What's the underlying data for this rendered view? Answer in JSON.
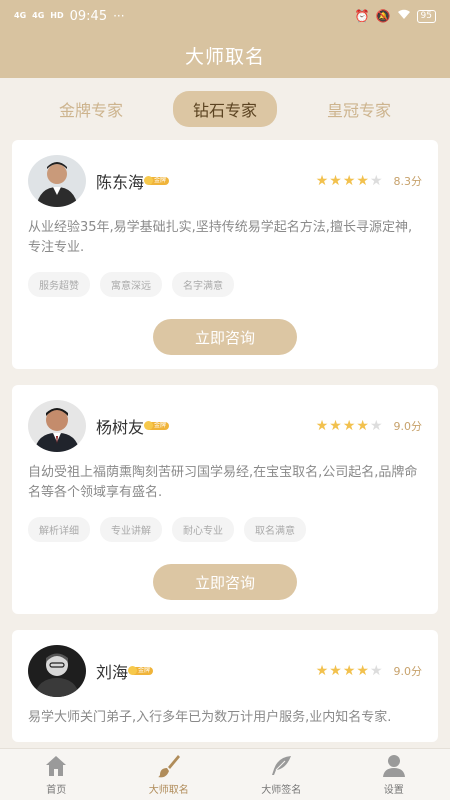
{
  "status_bar": {
    "signal1": "4G",
    "signal2": "4G",
    "hd": "HD",
    "time": "09:45",
    "more": "···",
    "battery": "95"
  },
  "header": {
    "title": "大师取名"
  },
  "tabs": [
    {
      "label": "金牌专家",
      "active": false
    },
    {
      "label": "钻石专家",
      "active": true
    },
    {
      "label": "皇冠专家",
      "active": false
    }
  ],
  "masters": [
    {
      "name": "陈东海",
      "badge": "金牌",
      "score": "8.3分",
      "rating": 4.5,
      "desc": "从业经验35年,易学基础扎实,坚持传统易学起名方法,擅长寻源定神,专注专业.",
      "tags": [
        "服务超赞",
        "寓意深远",
        "名字满意"
      ],
      "button": "立即咨询"
    },
    {
      "name": "杨树友",
      "badge": "金牌",
      "score": "9.0分",
      "rating": 4,
      "desc": "自幼受祖上福荫熏陶刻苦研习国学易经,在宝宝取名,公司起名,品牌命名等各个领域享有盛名.",
      "tags": [
        "解析详细",
        "专业讲解",
        "耐心专业",
        "取名满意"
      ],
      "button": "立即咨询"
    },
    {
      "name": "刘海",
      "badge": "金牌",
      "score": "9.0分",
      "rating": 4,
      "desc": "易学大师关门弟子,入行多年已为数万计用户服务,业内知名专家.",
      "tags": [],
      "button": ""
    }
  ],
  "nav": [
    {
      "label": "首页",
      "icon": "home-icon",
      "active": false
    },
    {
      "label": "大师取名",
      "icon": "brush-icon",
      "active": true
    },
    {
      "label": "大师签名",
      "icon": "feather-icon",
      "active": false
    },
    {
      "label": "设置",
      "icon": "user-icon",
      "active": false
    }
  ],
  "colors": {
    "header": "#d8c3a0",
    "accent": "#dcc6a3",
    "star": "#f2c14e",
    "score": "#c7a26c"
  }
}
